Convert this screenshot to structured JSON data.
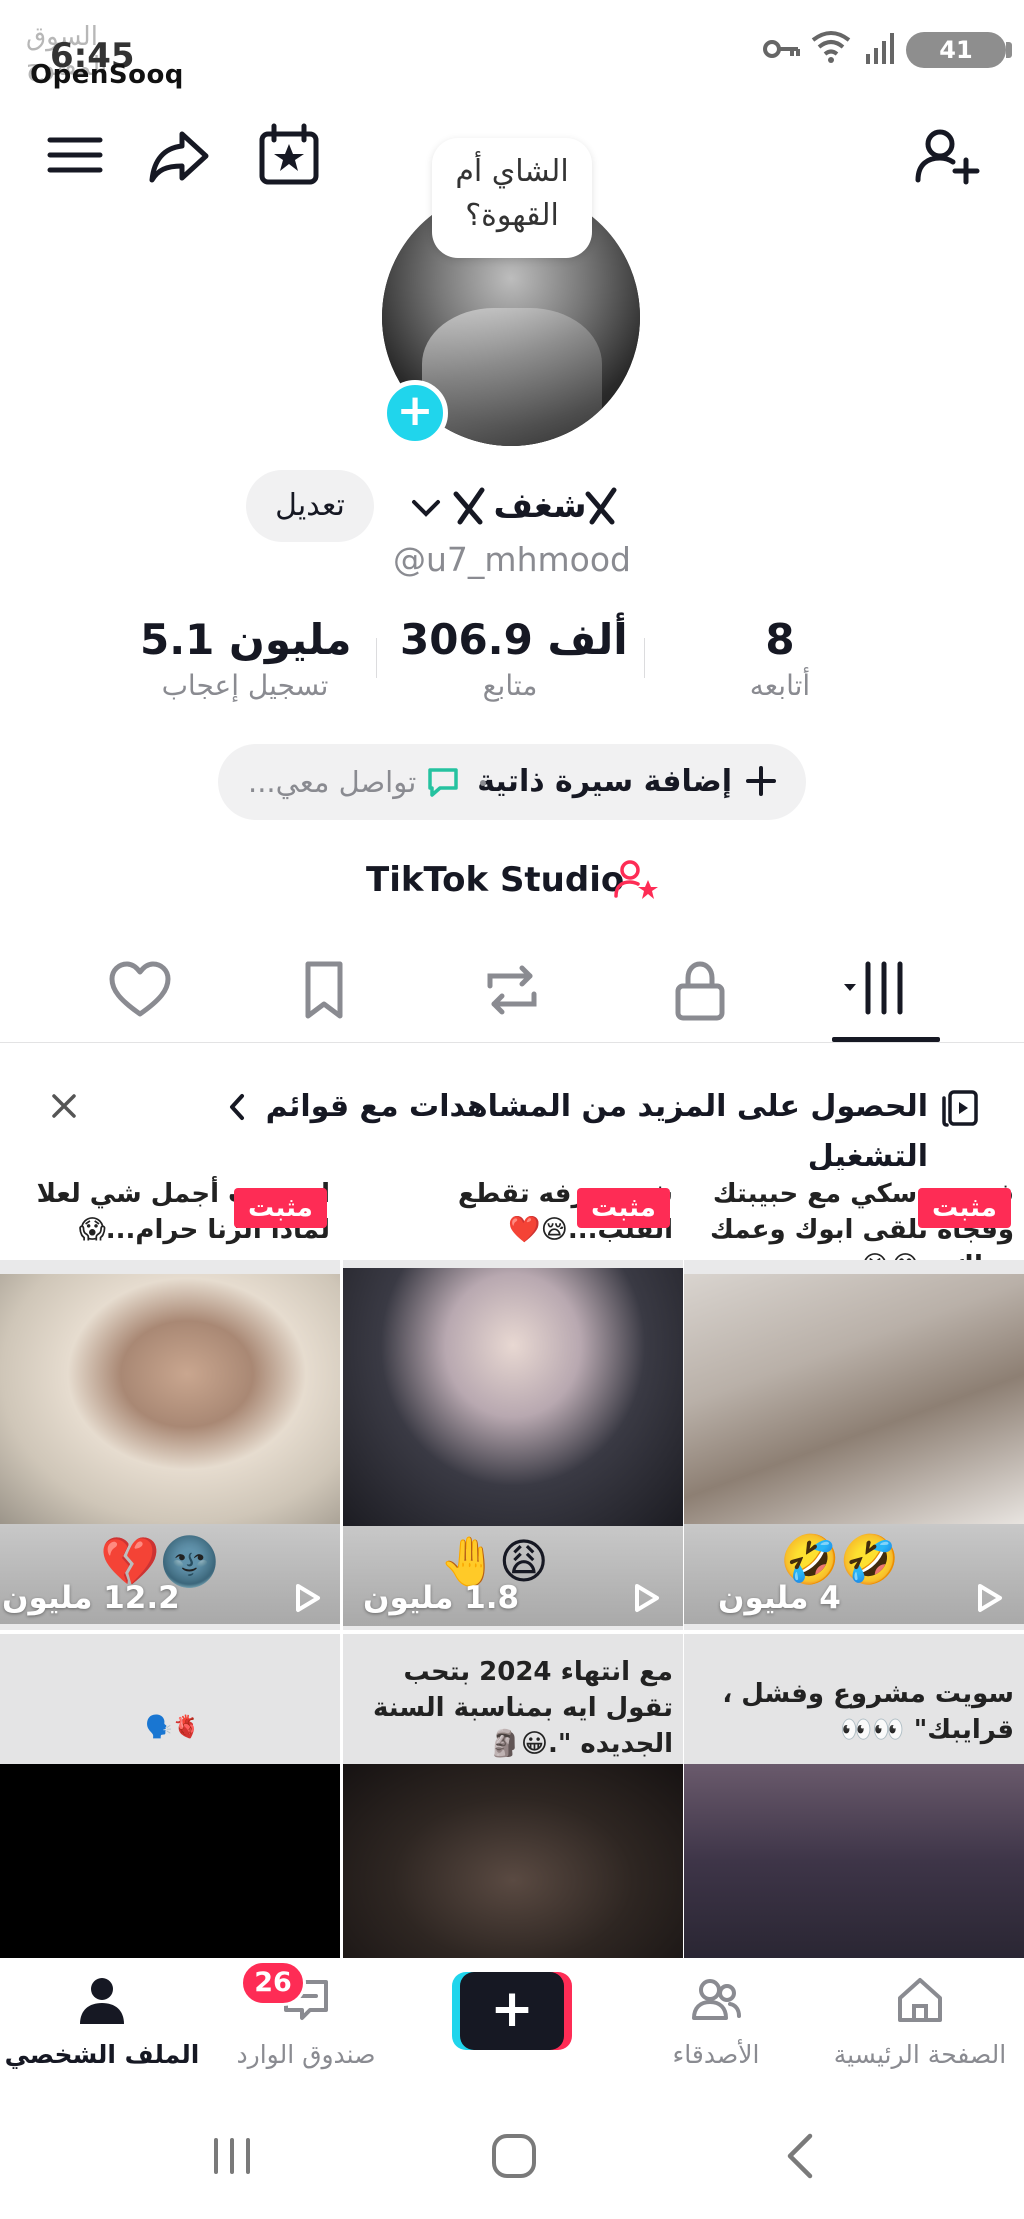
{
  "status_bar": {
    "watermark_arabic": "السوق المفتوح",
    "watermark_english": "OpenSooq",
    "time": "6:45",
    "battery": "41"
  },
  "profile": {
    "bubble_text_line1": "الشاي أم",
    "bubble_text_line2": "القهوة؟",
    "edit_label": "تعديل",
    "display_name": "شغف",
    "username": "@u7_mhmood"
  },
  "stats": [
    {
      "value": "8",
      "label": "أتابعه"
    },
    {
      "value": "306.9 ألف",
      "label": "متابع"
    },
    {
      "value": "5.1 مليون",
      "label": "تسجيل إعجاب"
    }
  ],
  "bio": {
    "add_label": "إضافة سيرة ذاتية",
    "contact_label": "تواصل معي..."
  },
  "studio": {
    "label": "TikTok Studio"
  },
  "banner": {
    "text": "الحصول على المزيد من المشاهدات مع قوائم التشغيل",
    "close_label": "×"
  },
  "videos": [
    {
      "caption": "فضيحة سكي مع حبيبتك وفجأه تلقى ابوك وعمك وراك...😂😭",
      "pinned": "مثبت",
      "views": "4 مليون",
      "emoji": "🤣🤣"
    },
    {
      "caption": "شي تعرفه تقطع القلب...😪❤️",
      "pinned": "مثبت",
      "views": "1.8 مليون",
      "emoji": "🤚😩"
    },
    {
      "caption": "اني بنت أجمل شي لعلا لماذا الزنا حرام...😱",
      "pinned": "مثبت",
      "views": "12.2 مليون",
      "emoji": "💔🌚"
    },
    {
      "caption": "سويت مشروع وفشل ، قرايبك\" 👀👀",
      "pinned": "",
      "views": "",
      "emoji": ""
    },
    {
      "caption": "مع انتهاء 2024 بتحب تقول ايه بمناسبة السنة الجديده \".😀🗿",
      "pinned": "",
      "views": "",
      "emoji": ""
    },
    {
      "caption": "🫀🗣️",
      "pinned": "",
      "views": "",
      "emoji": ""
    }
  ],
  "bottom_nav": {
    "home": "الصفحة الرئيسية",
    "friends": "الأصدقاء",
    "create": "+",
    "inbox": "صندوق الوارد",
    "inbox_badge": "26",
    "profile": "الملف الشخصي"
  },
  "colors": {
    "accent_red": "#fe2c55",
    "accent_cyan": "#20d5ec",
    "text_dark": "#161823",
    "text_gray": "#8a8b91"
  }
}
